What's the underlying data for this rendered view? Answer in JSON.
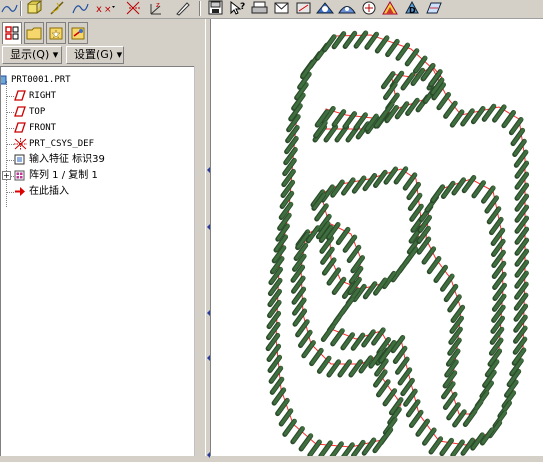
{
  "toolbar": {
    "left_icons": [
      "sketch-icon",
      "extrude-icon",
      "revolve-icon",
      "sweep-icon",
      "axis-icon",
      "point-icon",
      "coord-sys-icon",
      "pen-icon"
    ],
    "right_icons": [
      "save-icon",
      "context-help-icon",
      "print-icon",
      "email-icon",
      "repaint-icon",
      "zoom-in-icon",
      "zoom-out-icon",
      "refit-icon",
      "orient-icon",
      "view-manager-icon",
      "datum-plane-icon"
    ]
  },
  "model_tree": {
    "tabs": [
      "model-tree-tab",
      "folder-browser-tab",
      "favorites-tab",
      "connections-tab"
    ],
    "show_menu": "显示(Q) ▾",
    "settings_menu": "设置(G) ▾",
    "items": [
      {
        "label": "PRT0001.PRT",
        "icon": "part-icon"
      },
      {
        "label": "RIGHT",
        "icon": "datum-plane-icon"
      },
      {
        "label": "TOP",
        "icon": "datum-plane-icon"
      },
      {
        "label": "FRONT",
        "icon": "datum-plane-icon"
      },
      {
        "label": "PRT_CSYS_DEF",
        "icon": "csys-icon"
      },
      {
        "label": "输入特征 标识39",
        "icon": "import-feature-icon"
      },
      {
        "label": "阵列 1 / 复制 1",
        "icon": "pattern-icon"
      },
      {
        "label": "在此插入",
        "icon": "insert-here-arrow-icon"
      }
    ]
  },
  "colors": {
    "outline": "#ff2a2a",
    "rod": "#3f6e3f",
    "rod_edge": "#2a4a2a"
  }
}
